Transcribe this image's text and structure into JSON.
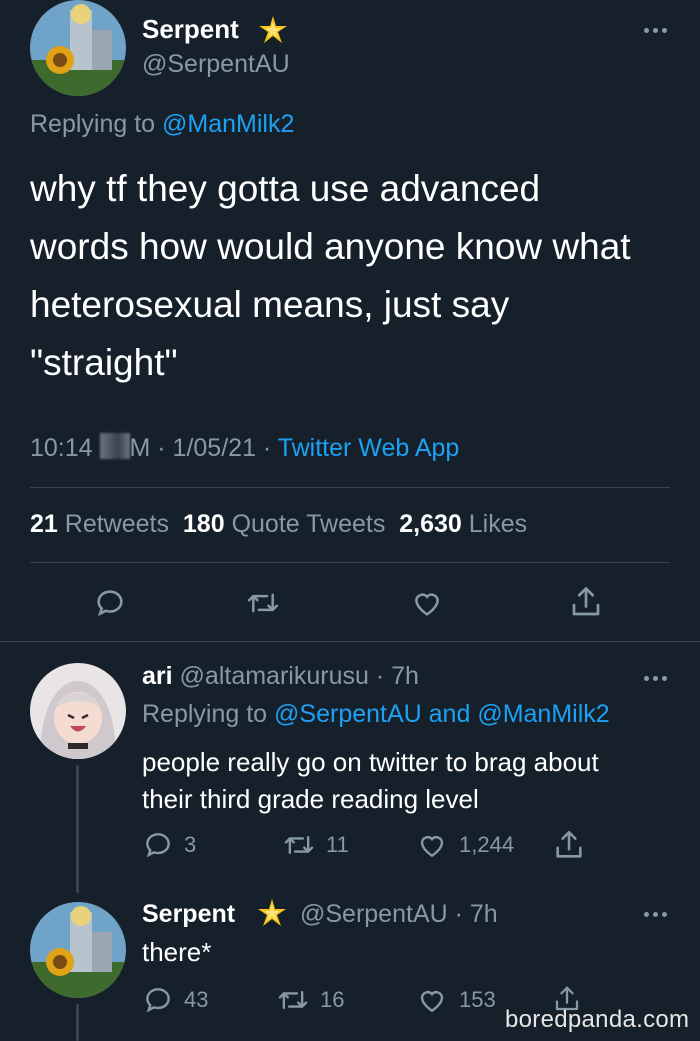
{
  "main_tweet": {
    "display_name": "Serpent",
    "handle": "@SerpentAU",
    "replying_prefix": "Replying to",
    "replying_to": "@ManMilk2",
    "text_lines": [
      "why tf they gotta use advanced",
      "words how would anyone know what",
      "heterosexual means, just say",
      "\"straight\""
    ],
    "time_visible_start": "10:14 ",
    "time_visible_end": "M · 1/05/21 · ",
    "source": "Twitter Web App",
    "stats": {
      "retweets_count": "21",
      "retweets_label": "Retweets",
      "quotes_count": "180",
      "quotes_label": "Quote Tweets",
      "likes_count": "2,630",
      "likes_label": "Likes"
    }
  },
  "reply_1": {
    "display_name": "ari",
    "handle_time": "@altamarikurusu · 7h",
    "replying_prefix": "Replying to",
    "replying_to_1": "@SerpentAU",
    "and": "and",
    "replying_to_2": "@ManMilk2",
    "text_lines": [
      "people really go on twitter to brag about",
      "their third grade reading level"
    ],
    "replies": "3",
    "retweets": "11",
    "likes": "1,244"
  },
  "reply_2": {
    "display_name": "Serpent",
    "handle_time": "@SerpentAU · 7h",
    "text": "there*",
    "replies": "43",
    "retweets": "16",
    "likes": "153"
  },
  "watermark": "boredpanda.com",
  "colors": {
    "background": "#15202b",
    "accent": "#1da1f2",
    "muted": "#8899a6",
    "divider": "#38444d",
    "verified_star": "#f5c518"
  }
}
